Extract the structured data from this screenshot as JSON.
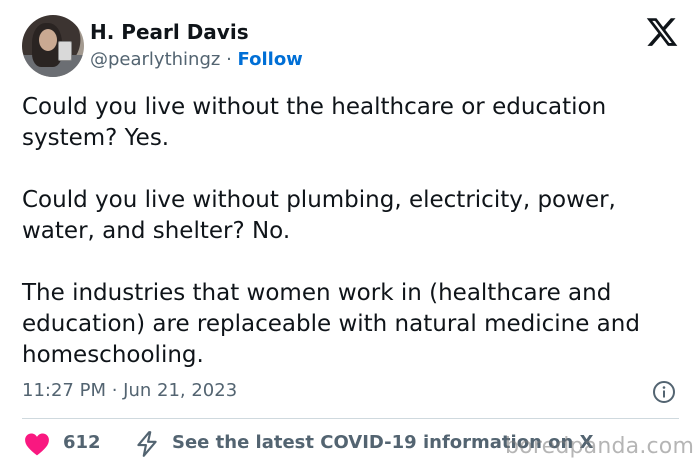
{
  "author": {
    "name": "H. Pearl Davis",
    "handle": "@pearlythingz",
    "separator": "·",
    "follow_label": "Follow"
  },
  "tweet": {
    "paragraphs": [
      "Could you live without the healthcare or education system? Yes.",
      "Could you live without plumbing, electricity, power, water, and shelter? No.",
      "The industries that women work in (healthcare and education) are replaceable with natural medicine and homeschooling."
    ],
    "timestamp": "11:27 PM · Jun 21, 2023"
  },
  "engagement": {
    "like_count": "612",
    "covid_link": "See the latest COVID-19 information on X"
  },
  "watermark": "boredpanda.com",
  "icons": {
    "logo": "x-logo-icon",
    "info": "info-icon",
    "like": "heart-icon",
    "covid": "lightning-bolt-icon"
  },
  "colors": {
    "text": "#0f1419",
    "secondary": "#536471",
    "follow": "#006fd6",
    "heart": "#f91880",
    "divider": "#cfd9de"
  }
}
